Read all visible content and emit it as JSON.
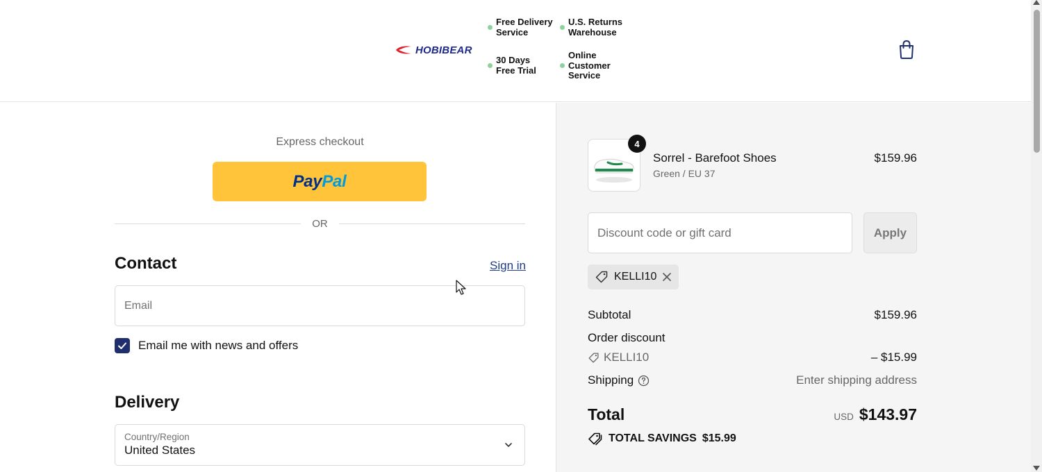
{
  "header": {
    "brand": "HOBIBEAR",
    "features": [
      {
        "line1": "Free Delivery",
        "line2": "Service"
      },
      {
        "line1": "U.S. Returns",
        "line2": "Warehouse"
      },
      {
        "line1": "30 Days",
        "line2": "Free Trial"
      },
      {
        "line1": "Online",
        "line2": "Customer",
        "line3": "Service"
      }
    ],
    "cart_icon": "shopping-bag-icon"
  },
  "checkout": {
    "express_label": "Express checkout",
    "paypal": {
      "pay": "Pay",
      "pal": "Pal"
    },
    "or_label": "OR",
    "contact": {
      "title": "Contact",
      "sign_in": "Sign in",
      "email_placeholder": "Email",
      "newsletter_label": "Email me with news and offers",
      "newsletter_checked": true
    },
    "delivery": {
      "title": "Delivery",
      "country_label": "Country/Region",
      "country_value": "United States"
    }
  },
  "summary": {
    "product": {
      "name": "Sorrel - Barefoot Shoes",
      "variant": "Green / EU 37",
      "price": "$159.96",
      "quantity": "4"
    },
    "discount_placeholder": "Discount code or gift card",
    "apply_label": "Apply",
    "applied_code": "KELLI10",
    "subtotal_label": "Subtotal",
    "subtotal_value": "$159.96",
    "order_discount_label": "Order discount",
    "discount_code": "KELLI10",
    "discount_value": "– $15.99",
    "shipping_label": "Shipping",
    "shipping_value": "Enter shipping address",
    "total_label": "Total",
    "total_currency": "USD",
    "total_value": "$143.97",
    "savings_label": "TOTAL SAVINGS",
    "savings_value": "$15.99"
  },
  "colors": {
    "paypal_yellow": "#ffc439",
    "brand_navy": "#1f2f6e",
    "link_blue": "#1f3c8a",
    "feature_dot": "#8fd19e"
  }
}
